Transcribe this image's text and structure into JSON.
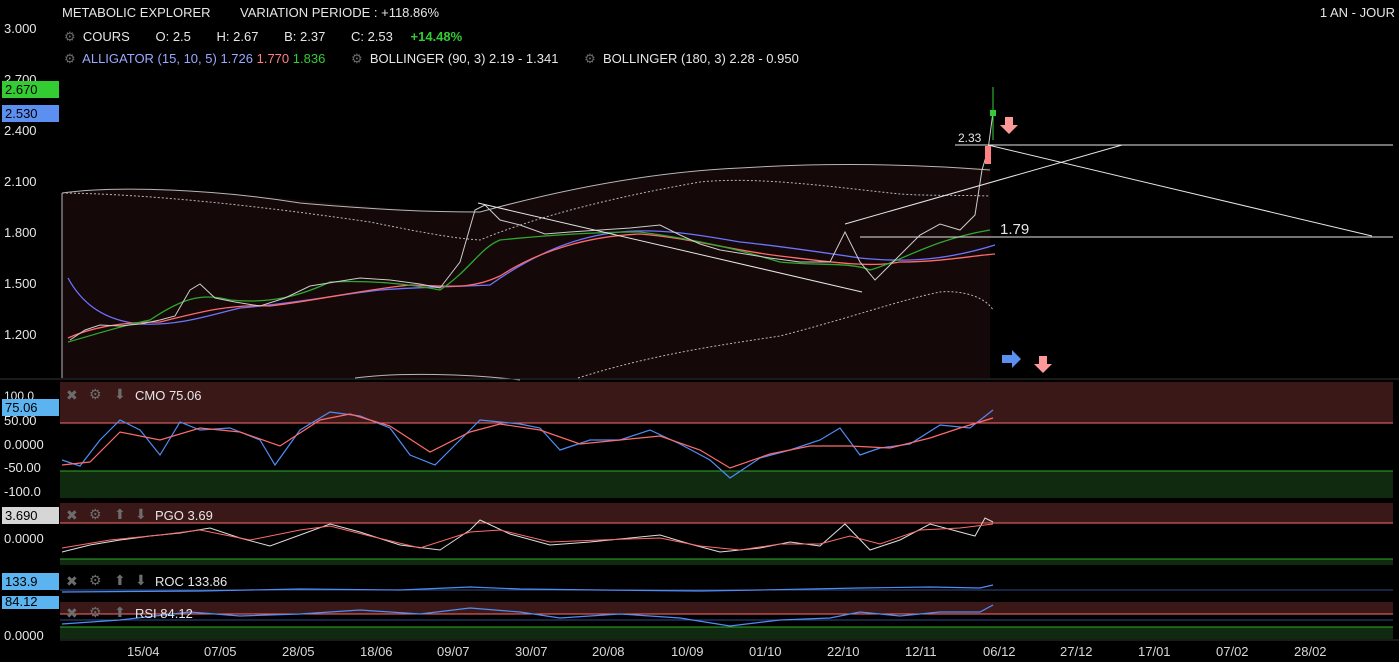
{
  "header": {
    "symbol": "METABOLIC EXPLORER",
    "variation": "VARIATION PERIODE : +118.86%",
    "period": "1 AN - JOUR"
  },
  "quote": {
    "label": "COURS",
    "open_label": "O:",
    "open": "2.5",
    "high_label": "H:",
    "high": "2.67",
    "low_label": "B:",
    "low": "2.37",
    "close_label": "C:",
    "close": "2.53",
    "change": "+14.48%"
  },
  "indicators": {
    "alligator_label": "ALLIGATOR (15, 10, 5)",
    "alligator_v1": "1.726",
    "alligator_v2": "1.770",
    "alligator_v3": "1.836",
    "boll90": "BOLLINGER (90, 3)  2.19 - 1.341",
    "boll180": "BOLLINGER (180, 3)  2.28 - 0.950"
  },
  "price_axis": [
    "3.000",
    "2.700",
    "2.400",
    "2.100",
    "1.800",
    "1.500",
    "1.200"
  ],
  "price_tags": {
    "high_tag": "2.670",
    "last_tag": "2.530"
  },
  "annotations": {
    "level_233": "2.33",
    "level_179": "1.79"
  },
  "panels": {
    "cmo": {
      "title": "CMO 75.06",
      "tag": "75.06",
      "axis": [
        "100.0",
        "50.00",
        "0.0000",
        "-50.00",
        "-100.0"
      ]
    },
    "pgo": {
      "title": "PGO 3.69",
      "tag": "3.690",
      "axis": [
        "0.0000"
      ]
    },
    "roc": {
      "title": "ROC 133.86",
      "tag": "133.9"
    },
    "rsi": {
      "title": "RSI 84.12",
      "tag": "84.12",
      "axis": [
        "0.0000"
      ]
    }
  },
  "x_axis": [
    "15/04",
    "07/05",
    "28/05",
    "18/06",
    "09/07",
    "30/07",
    "20/08",
    "10/09",
    "01/10",
    "22/10",
    "12/11",
    "06/12",
    "27/12",
    "17/01",
    "07/02",
    "28/02"
  ],
  "colors": {
    "up": "#33cc33",
    "down": "#ff8080",
    "accent_blue": "#4f8df5",
    "tag_green": "#33cc33",
    "tag_blue": "#5b8ff0"
  },
  "chart_data": {
    "type": "line",
    "title": "METABOLIC EXPLORER",
    "x": [
      "15/04",
      "07/05",
      "28/05",
      "18/06",
      "09/07",
      "30/07",
      "20/08",
      "10/09",
      "01/10",
      "22/10",
      "12/11",
      "06/12"
    ],
    "series": [
      {
        "name": "COURS",
        "values": [
          1.22,
          1.45,
          1.38,
          1.52,
          1.5,
          1.82,
          1.8,
          1.62,
          1.62,
          1.55,
          1.78,
          2.53
        ]
      }
    ],
    "ylim": [
      1.0,
      3.0
    ]
  }
}
